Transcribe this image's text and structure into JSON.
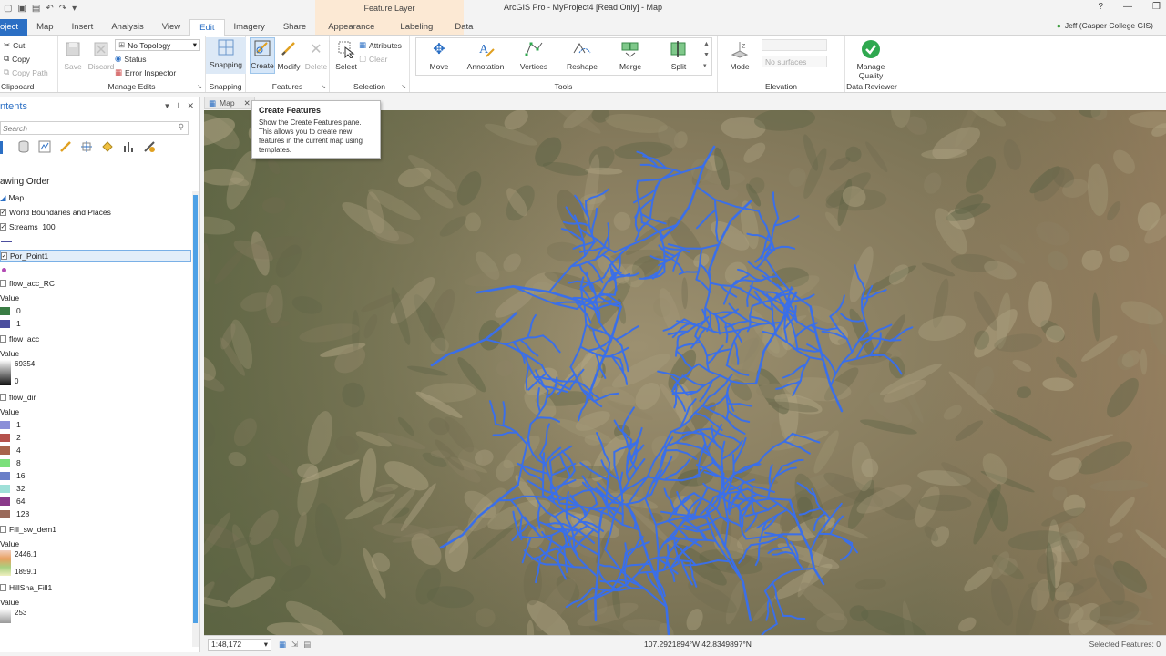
{
  "window": {
    "title": "ArcGIS Pro - MyProject4 [Read Only] - Map",
    "context_tab_header": "Feature Layer",
    "user": "Jeff (Casper College GIS)"
  },
  "tabs": [
    {
      "label": "oject"
    },
    {
      "label": "Map"
    },
    {
      "label": "Insert"
    },
    {
      "label": "Analysis"
    },
    {
      "label": "View"
    },
    {
      "label": "Edit"
    },
    {
      "label": "Imagery"
    },
    {
      "label": "Share"
    },
    {
      "label": "Appearance"
    },
    {
      "label": "Labeling"
    },
    {
      "label": "Data"
    }
  ],
  "ribbon": {
    "clipboard": {
      "cut": "Cut",
      "copy": "Copy",
      "copy_path": "Copy Path",
      "label": "Clipboard"
    },
    "manage_edits": {
      "save": "Save",
      "discard": "Discard",
      "topology": "No Topology",
      "status": "Status",
      "error_inspector": "Error Inspector",
      "label": "Manage Edits"
    },
    "snapping": {
      "snapping": "Snapping",
      "label": "Snapping"
    },
    "features": {
      "create": "Create",
      "modify": "Modify",
      "delete": "Delete",
      "label": "Features"
    },
    "selection": {
      "select": "Select",
      "attributes": "Attributes",
      "clear": "Clear",
      "label": "Selection"
    },
    "tools": {
      "move": "Move",
      "annotation": "Annotation",
      "vertices": "Vertices",
      "reshape": "Reshape",
      "merge": "Merge",
      "split": "Split",
      "label": "Tools"
    },
    "elevation": {
      "mode": "Mode",
      "surface": "No surfaces",
      "label": "Elevation"
    },
    "data_reviewer": {
      "manage_quality": "Manage",
      "manage_quality_2": "Quality",
      "label": "Data Reviewer"
    }
  },
  "tooltip": {
    "title": "Create Features",
    "body": "Show the Create Features pane. This allows you to create new features in the current map using templates."
  },
  "contents": {
    "title": "ntents",
    "search_placeholder": "Search",
    "drawing_order": "awing Order",
    "map": "Map",
    "layers": {
      "world": "World Boundaries and Places",
      "streams": "Streams_100",
      "por": "Por_Point1",
      "flow_acc_rc": "flow_acc_RC",
      "flow_acc_rc_value": "Value",
      "flow_acc_rc_items": [
        {
          "label": "0",
          "color": "#3a7d44"
        },
        {
          "label": "1",
          "color": "#4b4e9e"
        }
      ],
      "flow_acc": "flow_acc",
      "flow_acc_value": "Value",
      "flow_acc_max": "69354",
      "flow_acc_min": "0",
      "flow_dir": "flow_dir",
      "flow_dir_value": "Value",
      "flow_dir_items": [
        {
          "label": "1",
          "color": "#8b8fd8"
        },
        {
          "label": "2",
          "color": "#b5524c"
        },
        {
          "label": "4",
          "color": "#a8644c"
        },
        {
          "label": "8",
          "color": "#7be07b"
        },
        {
          "label": "16",
          "color": "#6a7fc8"
        },
        {
          "label": "32",
          "color": "#9fe0d8"
        },
        {
          "label": "64",
          "color": "#8a3a8a"
        },
        {
          "label": "128",
          "color": "#9a6a5a"
        }
      ],
      "fill": "Fill_sw_dem1",
      "fill_value": "Value",
      "fill_max": "2446.1",
      "fill_min": "1859.1",
      "hillshade": "HillSha_Fill1",
      "hillshade_value": "Value",
      "hillshade_max": "253"
    }
  },
  "map": {
    "tab": "Map",
    "scale": "1:48,172",
    "coords": "107.2921894°W 42.8349897°N",
    "selected_features": "Selected Features: 0",
    "stream_color": "#3b6fe8"
  }
}
